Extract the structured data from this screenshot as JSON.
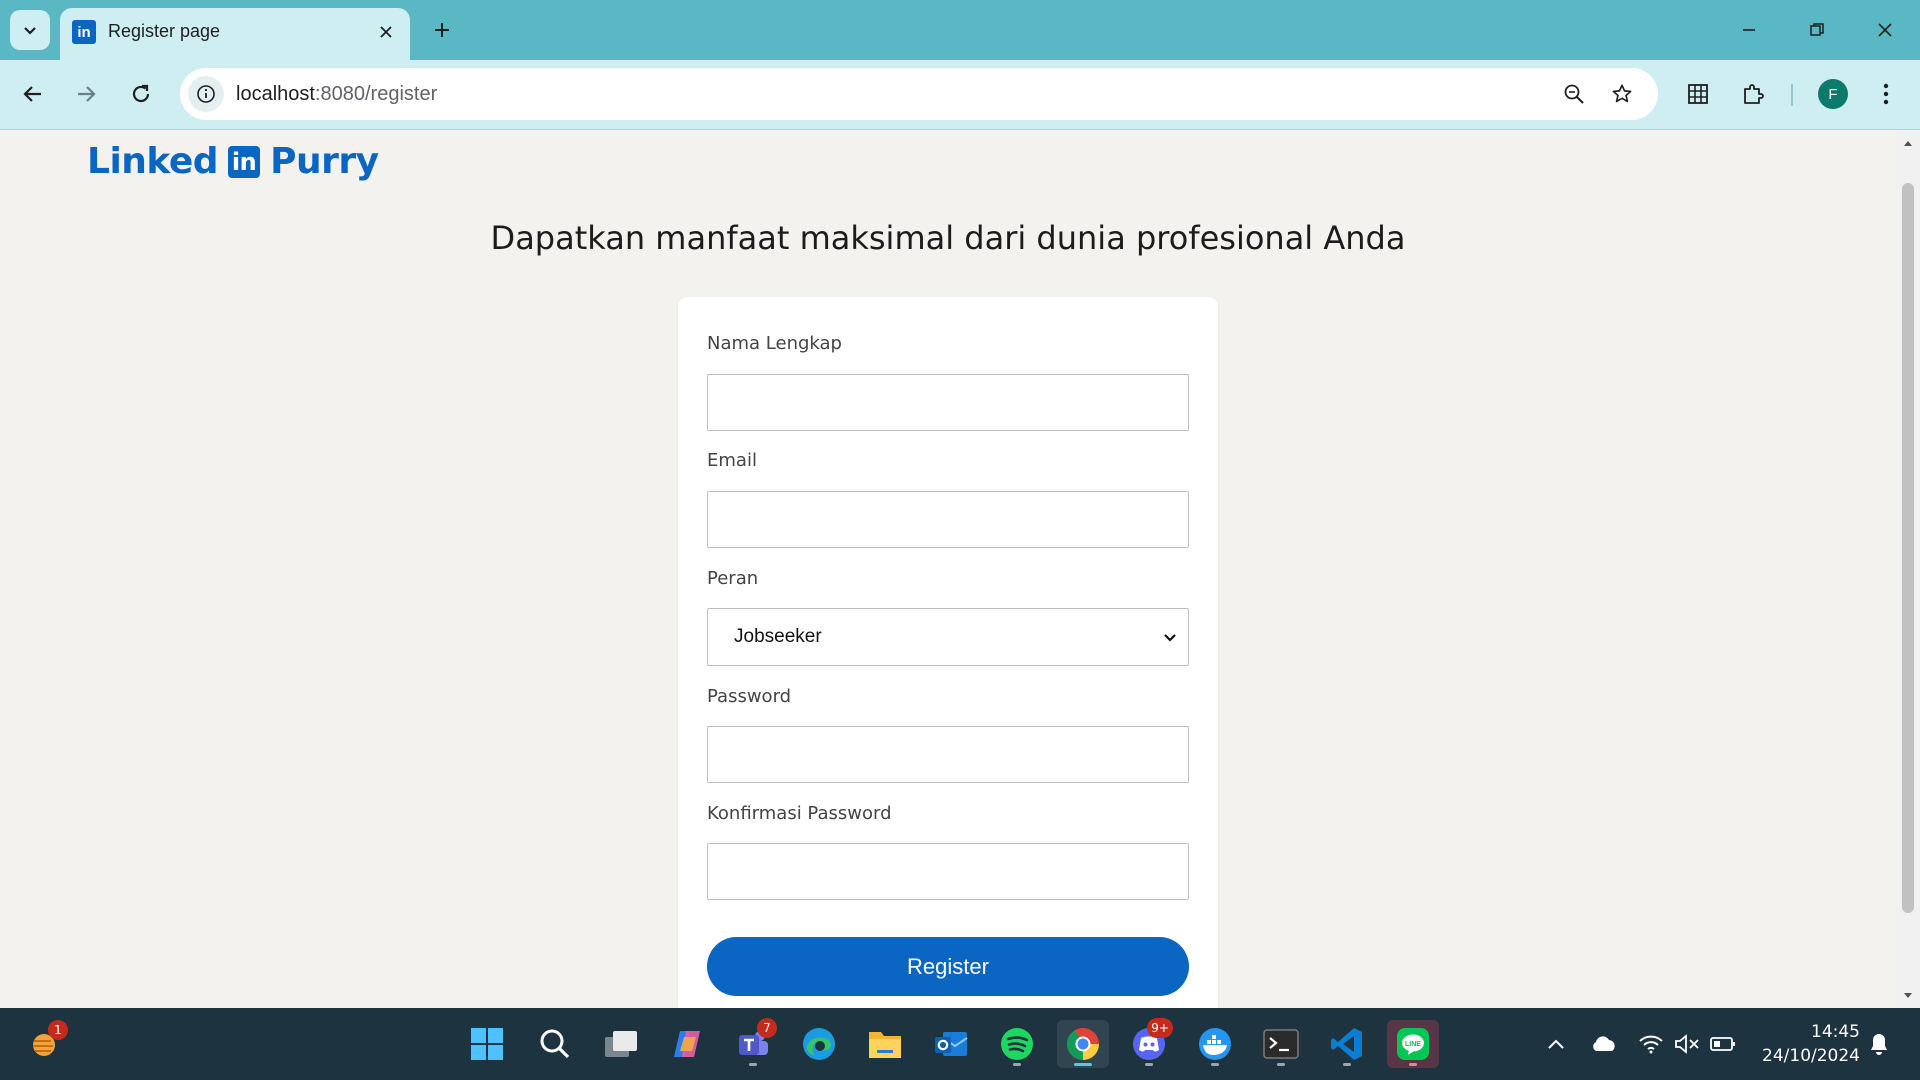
{
  "browser": {
    "tab": {
      "title": "Register page",
      "favicon": "in"
    },
    "url": {
      "host": "localhost",
      "path": ":8080/register"
    },
    "avatar_letter": "F"
  },
  "page": {
    "logo": {
      "left": "Linked",
      "box": "in",
      "right": "Purry"
    },
    "headline": "Dapatkan manfaat maksimal dari dunia profesional Anda",
    "form": {
      "name_label": "Nama Lengkap",
      "name_value": "",
      "email_label": "Email",
      "email_value": "",
      "role_label": "Peran",
      "role_value": "Jobseeker",
      "password_label": "Password",
      "password_value": "",
      "confirm_label": "Konfirmasi Password",
      "confirm_value": "",
      "submit_label": "Register"
    }
  },
  "taskbar": {
    "widgets_badge": "1",
    "teams_badge": "7",
    "discord_badge": "9+",
    "time": "14:45",
    "date": "24/10/2024"
  },
  "colors": {
    "browser_frame": "#5ab8c4",
    "toolbar": "#cfeef2",
    "linkedin_blue": "#0a66c2",
    "page_bg": "#f3f2ef",
    "taskbar": "#1d3340"
  },
  "icons": [
    "tab-list-icon",
    "close-icon",
    "plus-icon",
    "minimize-icon",
    "restore-icon",
    "back-icon",
    "forward-icon",
    "reload-icon",
    "site-info-icon",
    "zoom-icon",
    "star-icon",
    "grid-icon",
    "extensions-icon",
    "menu-icon",
    "chevron-down-icon",
    "windows-start-icon",
    "search-icon",
    "task-view-icon",
    "copilot-icon",
    "teams-icon",
    "edge-icon",
    "file-explorer-icon",
    "outlook-icon",
    "spotify-icon",
    "chrome-icon",
    "discord-icon",
    "docker-icon",
    "terminal-icon",
    "vscode-icon",
    "line-icon",
    "tray-chevron-icon",
    "onedrive-icon",
    "wifi-icon",
    "volume-muted-icon",
    "battery-icon",
    "notification-bell-icon"
  ]
}
